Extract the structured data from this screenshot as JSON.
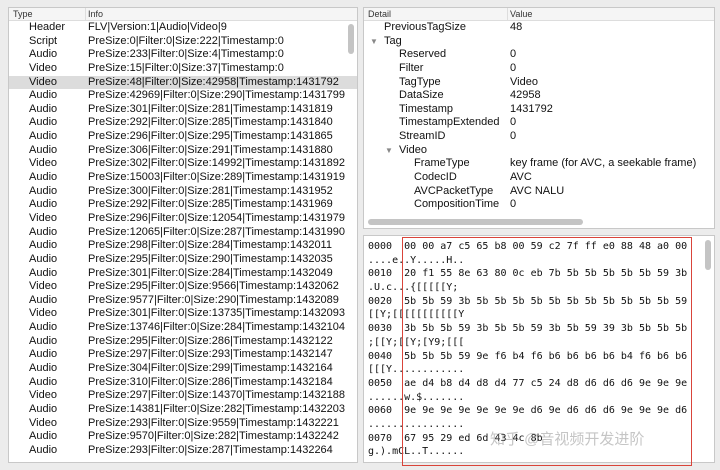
{
  "tag_list": {
    "columns": [
      "Type",
      "Info"
    ],
    "selected_index": 4,
    "rows": [
      {
        "type": "Header",
        "info": "FLV|Version:1|Audio|Video|9"
      },
      {
        "type": "Script",
        "info": "PreSize:0|Filter:0|Size:222|Timestamp:0"
      },
      {
        "type": "Audio",
        "info": "PreSize:233|Filter:0|Size:4|Timestamp:0"
      },
      {
        "type": "Video",
        "info": "PreSize:15|Filter:0|Size:37|Timestamp:0"
      },
      {
        "type": "Video",
        "info": "PreSize:48|Filter:0|Size:42958|Timestamp:1431792"
      },
      {
        "type": "Audio",
        "info": "PreSize:42969|Filter:0|Size:290|Timestamp:1431799"
      },
      {
        "type": "Audio",
        "info": "PreSize:301|Filter:0|Size:281|Timestamp:1431819"
      },
      {
        "type": "Audio",
        "info": "PreSize:292|Filter:0|Size:285|Timestamp:1431840"
      },
      {
        "type": "Audio",
        "info": "PreSize:296|Filter:0|Size:295|Timestamp:1431865"
      },
      {
        "type": "Audio",
        "info": "PreSize:306|Filter:0|Size:291|Timestamp:1431880"
      },
      {
        "type": "Video",
        "info": "PreSize:302|Filter:0|Size:14992|Timestamp:1431892"
      },
      {
        "type": "Audio",
        "info": "PreSize:15003|Filter:0|Size:289|Timestamp:1431919"
      },
      {
        "type": "Audio",
        "info": "PreSize:300|Filter:0|Size:281|Timestamp:1431952"
      },
      {
        "type": "Audio",
        "info": "PreSize:292|Filter:0|Size:285|Timestamp:1431969"
      },
      {
        "type": "Video",
        "info": "PreSize:296|Filter:0|Size:12054|Timestamp:1431979"
      },
      {
        "type": "Audio",
        "info": "PreSize:12065|Filter:0|Size:287|Timestamp:1431990"
      },
      {
        "type": "Audio",
        "info": "PreSize:298|Filter:0|Size:284|Timestamp:1432011"
      },
      {
        "type": "Audio",
        "info": "PreSize:295|Filter:0|Size:290|Timestamp:1432035"
      },
      {
        "type": "Audio",
        "info": "PreSize:301|Filter:0|Size:284|Timestamp:1432049"
      },
      {
        "type": "Video",
        "info": "PreSize:295|Filter:0|Size:9566|Timestamp:1432062"
      },
      {
        "type": "Audio",
        "info": "PreSize:9577|Filter:0|Size:290|Timestamp:1432089"
      },
      {
        "type": "Video",
        "info": "PreSize:301|Filter:0|Size:13735|Timestamp:1432093"
      },
      {
        "type": "Audio",
        "info": "PreSize:13746|Filter:0|Size:284|Timestamp:1432104"
      },
      {
        "type": "Audio",
        "info": "PreSize:295|Filter:0|Size:286|Timestamp:1432122"
      },
      {
        "type": "Audio",
        "info": "PreSize:297|Filter:0|Size:293|Timestamp:1432147"
      },
      {
        "type": "Audio",
        "info": "PreSize:304|Filter:0|Size:299|Timestamp:1432164"
      },
      {
        "type": "Audio",
        "info": "PreSize:310|Filter:0|Size:286|Timestamp:1432184"
      },
      {
        "type": "Video",
        "info": "PreSize:297|Filter:0|Size:14370|Timestamp:1432188"
      },
      {
        "type": "Audio",
        "info": "PreSize:14381|Filter:0|Size:282|Timestamp:1432203"
      },
      {
        "type": "Video",
        "info": "PreSize:293|Filter:0|Size:9559|Timestamp:1432221"
      },
      {
        "type": "Audio",
        "info": "PreSize:9570|Filter:0|Size:282|Timestamp:1432242"
      },
      {
        "type": "Audio",
        "info": "PreSize:293|Filter:0|Size:287|Timestamp:1432264"
      }
    ]
  },
  "detail": {
    "columns": [
      "Detail",
      "Value"
    ],
    "rows": [
      {
        "key": "PreviousTagSize",
        "value": "48",
        "level": 0,
        "expander": false
      },
      {
        "key": "Tag",
        "value": "",
        "level": 0,
        "expander": true
      },
      {
        "key": "Reserved",
        "value": "0",
        "level": 1,
        "expander": false
      },
      {
        "key": "Filter",
        "value": "0",
        "level": 1,
        "expander": false
      },
      {
        "key": "TagType",
        "value": "Video",
        "level": 1,
        "expander": false
      },
      {
        "key": "DataSize",
        "value": "42958",
        "level": 1,
        "expander": false
      },
      {
        "key": "Timestamp",
        "value": "1431792",
        "level": 1,
        "expander": false
      },
      {
        "key": "TimestampExtended",
        "value": "0",
        "level": 1,
        "expander": false
      },
      {
        "key": "StreamID",
        "value": "0",
        "level": 1,
        "expander": false
      },
      {
        "key": "Video",
        "value": "",
        "level": 1,
        "expander": true
      },
      {
        "key": "FrameType",
        "value": "key frame (for AVC, a seekable frame)",
        "level": 2,
        "expander": false
      },
      {
        "key": "CodecID",
        "value": "AVC",
        "level": 2,
        "expander": false
      },
      {
        "key": "AVCPacketType",
        "value": "AVC NALU",
        "level": 2,
        "expander": false
      },
      {
        "key": "CompositionTime",
        "value": "0",
        "level": 2,
        "expander": false
      }
    ]
  },
  "hex": {
    "lines": [
      {
        "offset": "0000",
        "bytes": "00 00 a7 c5 65 b8 00 59 c2 7f ff e0 88 48 a0 00",
        "ascii": "....e..Y.....H.."
      },
      {
        "offset": "0010",
        "bytes": "20 f1 55 8e 63 80 0c eb 7b 5b 5b 5b 5b 5b 59 3b",
        "ascii": ".U.c...{[[[[[Y;"
      },
      {
        "offset": "0020",
        "bytes": "5b 5b 59 3b 5b 5b 5b 5b 5b 5b 5b 5b 5b 5b 5b 59",
        "ascii": "[[Y;[[[[[[[[[[[Y"
      },
      {
        "offset": "0030",
        "bytes": "3b 5b 5b 59 3b 5b 5b 59 3b 5b 59 39 3b 5b 5b 5b",
        "ascii": ";[[Y;[[Y;[Y9;[[["
      },
      {
        "offset": "0040",
        "bytes": "5b 5b 5b 59 9e f6 b4 f6 b6 b6 b6 b6 b4 f6 b6 b6",
        "ascii": "[[[Y............"
      },
      {
        "offset": "0050",
        "bytes": "ae d4 b8 d4 d8 d4 77 c5 24 d8 d6 d6 d6 9e 9e 9e",
        "ascii": "......w.$......."
      },
      {
        "offset": "0060",
        "bytes": "9e 9e 9e 9e 9e 9e 9e d6 9e d6 d6 d6 9e 9e 9e d6",
        "ascii": "................"
      },
      {
        "offset": "0070",
        "bytes": "67 95 29 ed 6d 43 4c 8b",
        "ascii": "g.).mCL..T......"
      }
    ]
  },
  "watermark": "知乎 @音视频开发进阶",
  "colors": {
    "highlight_box": "#d9443a",
    "selected_row": "#dcdcdc"
  }
}
